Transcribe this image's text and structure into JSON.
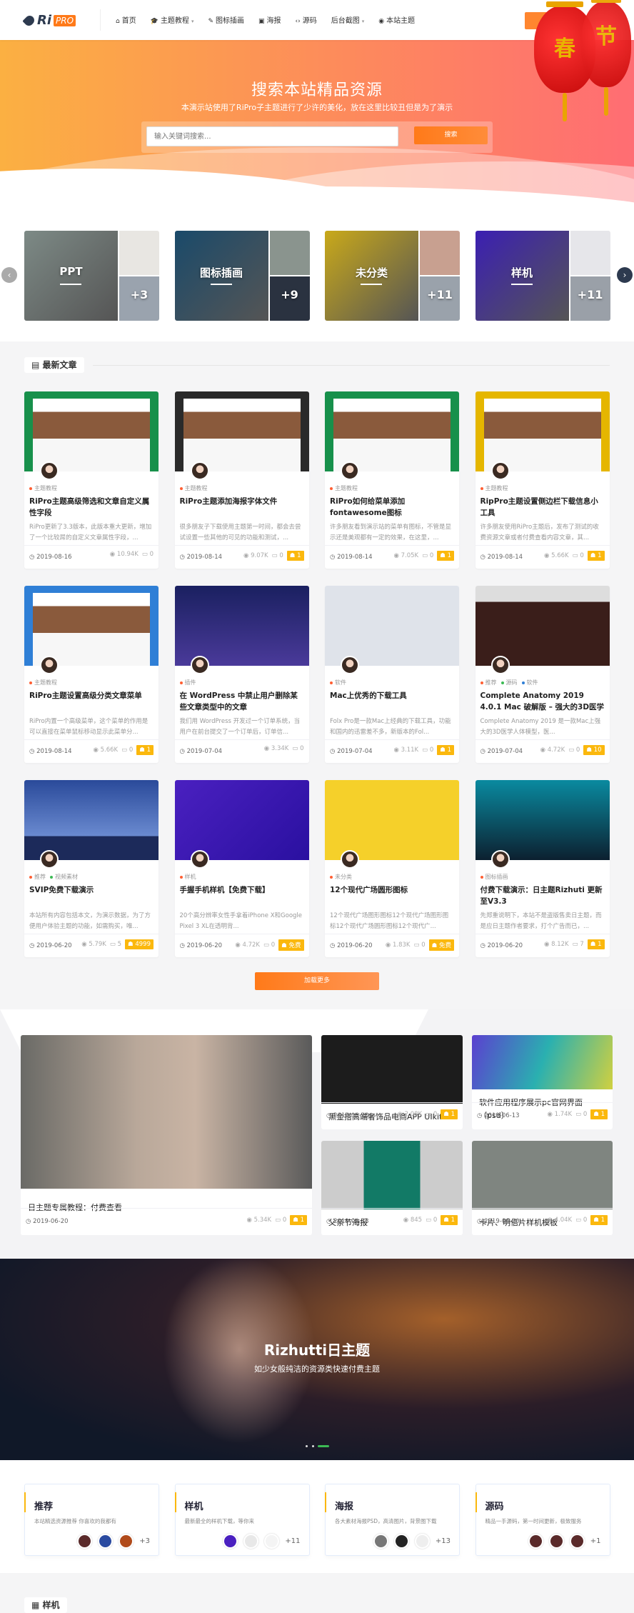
{
  "header": {
    "logo": "RiPRO",
    "logo_ri": "Ri",
    "logo_pro": "PRO",
    "login": "登录",
    "lanterns": [
      "春",
      "节"
    ],
    "nav": [
      {
        "icon": "home-icon",
        "glyph": "⌂",
        "label": "首页"
      },
      {
        "icon": "graduation-cap-icon",
        "glyph": "🎓",
        "label": "主题教程",
        "dropdown": true
      },
      {
        "icon": "magic-wand-icon",
        "glyph": "✎",
        "label": "图标插画"
      },
      {
        "icon": "image-icon",
        "glyph": "▣",
        "label": "海报"
      },
      {
        "icon": "code-icon",
        "glyph": "‹›",
        "label": "源码"
      },
      {
        "label": "后台截图",
        "dropdown": true
      },
      {
        "icon": "target-icon",
        "glyph": "◉",
        "label": "本站主题"
      }
    ]
  },
  "hero": {
    "title": "搜索本站精品资源",
    "subtitle": "本演示站使用了RiPro子主题进行了少许的美化，放在这里比较丑但是为了演示",
    "placeholder": "输入关键词搜索...",
    "button": "搜索"
  },
  "categories": [
    {
      "label": "PPT",
      "count": "+3"
    },
    {
      "label": "图标插画",
      "count": "+9"
    },
    {
      "label": "未分类",
      "count": "+11"
    },
    {
      "label": "样机",
      "count": "+11"
    }
  ],
  "latest": {
    "title": "最新文章",
    "load_more": "加载更多",
    "posts": [
      {
        "cats": [
          "主题教程"
        ],
        "title": "RiPro主题高级筛选和文章自定义属性字段",
        "excerpt": "RiPro更新了3.3版本，此版本重大更新，增加了一个比较屌的自定义文章属性字段，...",
        "date": "2019-08-16",
        "views": "10.94K",
        "comments": "0",
        "badge": null
      },
      {
        "cats": [
          "主题教程"
        ],
        "title": "RiPro主题添加海报字体文件",
        "excerpt": "很多朋友子下载使用主题第一时间，都会去尝试设置一些其他的可见的功能和测试，...",
        "date": "2019-08-14",
        "views": "9.07K",
        "comments": "0",
        "badge": "1"
      },
      {
        "cats": [
          "主题教程"
        ],
        "title": "RiPro如何给菜单添加fontawesome图标",
        "excerpt": "许多朋友看到演示站的菜单有图标，不管是显示还是美观都有一定的效果，在这里，...",
        "date": "2019-08-14",
        "views": "7.05K",
        "comments": "0",
        "badge": "1"
      },
      {
        "cats": [
          "主题教程"
        ],
        "title": "RipPro主题设置侧边栏下载信息小工具",
        "excerpt": "许多朋友使用RiPro主题后，发布了测试的收费资源文章或者付费查看内容文章，其...",
        "date": "2019-08-14",
        "views": "5.66K",
        "comments": "0",
        "badge": "1"
      },
      {
        "cats": [
          "主题教程"
        ],
        "title": "RiPro主题设置高级分类文章菜单",
        "excerpt": "RiPro内置一个高级菜单，这个菜单的作用是可以直接在菜单鼠标移动显示此菜单分...",
        "date": "2019-08-14",
        "views": "5.66K",
        "comments": "0",
        "badge": "1"
      },
      {
        "cats": [
          "插件"
        ],
        "title": "在 WordPress 中禁止用户删除某些文章类型中的文章",
        "excerpt": "我们用 WordPress 开发过一个订单系统，当用户在前台提交了一个订单后，订单信...",
        "date": "2019-07-04",
        "views": "3.34K",
        "comments": "0",
        "badge": null
      },
      {
        "cats": [
          "软件"
        ],
        "title": "Mac上优秀的下载工具",
        "excerpt": "Folx Pro是一款Mac上经典的下载工具，功能和国内的迅雷差不多，新版本的Fol...",
        "date": "2019-07-04",
        "views": "3.11K",
        "comments": "0",
        "badge": "1"
      },
      {
        "cats": [
          "推荐",
          "源码",
          "软件"
        ],
        "title": "Complete Anatomy 2019 4.0.1 Mac 破解版 – 强大的3D医学人体模型",
        "excerpt": "Complete Anatomy 2019 是一款Mac上强大的3D医学人体模型，医...",
        "date": "2019-07-04",
        "views": "4.72K",
        "comments": "0",
        "badge": "10"
      },
      {
        "cats": [
          "推荐",
          "视频素材"
        ],
        "title": "SVIP免费下载演示",
        "excerpt": "本站所有内容包括本文，为演示数据，为了方便用户体验主题的功能，如需购买，唯...",
        "date": "2019-06-20",
        "views": "5.79K",
        "comments": "5",
        "badge": "4999"
      },
      {
        "cats": [
          "样机"
        ],
        "title": "手握手机样机【免费下载】",
        "excerpt": "20个高分辨率女性手拿着iPhone X和Google Pixel 3 XL在透明背...",
        "date": "2019-06-20",
        "views": "4.72K",
        "comments": "0",
        "badge": "免费"
      },
      {
        "cats": [
          "未分类"
        ],
        "title": "12个现代广场圆形图标",
        "excerpt": "12个现代广场图形图标12个现代广场图形图标12个现代广场圆形图标12个现代广...",
        "date": "2019-06-20",
        "views": "1.83K",
        "comments": "0",
        "badge": "免费"
      },
      {
        "cats": [
          "图标插画"
        ],
        "title": "付费下载演示：日主题Rizhuti 更新至V3.3",
        "excerpt": "先郑重说明下，本站不是盗版售卖日主题，而是应日主题作者要求，打个广告而已，...",
        "date": "2019-06-20",
        "views": "8.12K",
        "comments": "7",
        "badge": "1"
      }
    ]
  },
  "featured": [
    {
      "title": "日主题专属教程：付费查看",
      "date": "2019-06-20",
      "views": "5.34K",
      "comments": "0",
      "badge": "1"
    },
    {
      "title": "黑金搭高端奢饰品电商APP UIkit",
      "date": "2019-06-20",
      "views": "2.08K",
      "comments": "0",
      "badge": "1"
    },
    {
      "title": "软件应用程序展示pc官网界面（psd）",
      "date": "2019-06-13",
      "views": "1.74K",
      "comments": "0",
      "badge": "1"
    },
    {
      "title": "父亲节海报",
      "date": "2019-06-13",
      "views": "845",
      "comments": "0",
      "badge": "1"
    },
    {
      "title": "卡片、明信片样机模板",
      "date": "2019-06-20",
      "views": "4.04K",
      "comments": "0",
      "badge": "1"
    }
  ],
  "banner": {
    "title": "Rizhutti日主题",
    "subtitle": "如少女般纯洁的资源类快速付费主题",
    "active_slide": 3,
    "slides": 3
  },
  "topics": [
    {
      "title": "推荐",
      "desc": "本站精选资源推荐 你喜欢的我都有",
      "more": "+3"
    },
    {
      "title": "样机",
      "desc": "最新最全的样机下载，等你来",
      "more": "+11"
    },
    {
      "title": "海报",
      "desc": "各大素材海报PSD，高清图片，背景图下载",
      "more": "+13"
    },
    {
      "title": "源码",
      "desc": "精品一手源码，第一时间更新，极致服务",
      "more": "+1"
    }
  ],
  "next_section": {
    "title": "样机"
  },
  "colors": {
    "accent": "#ff7a19",
    "badge": "#fbb80d",
    "nav_dark": "#2d3a4f"
  }
}
